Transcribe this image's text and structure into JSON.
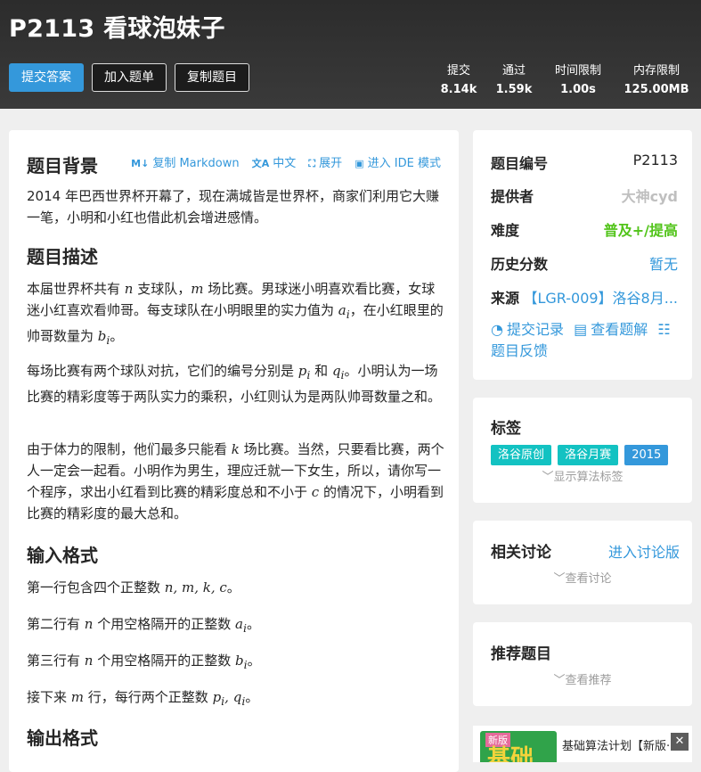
{
  "header": {
    "title": "P2113 看球泡妹子",
    "buttons": {
      "submit": "提交答案",
      "add_list": "加入题单",
      "copy": "复制题目"
    },
    "stats": [
      {
        "label": "提交",
        "value": "8.14k"
      },
      {
        "label": "通过",
        "value": "1.59k"
      },
      {
        "label": "时间限制",
        "value": "1.00s"
      },
      {
        "label": "内存限制",
        "value": "125.00MB"
      }
    ]
  },
  "main": {
    "toolbar": {
      "copy_md": "复制 Markdown",
      "lang": "中文",
      "expand": "展开",
      "ide": "进入 IDE 模式"
    },
    "background_title": "题目背景",
    "background_text": "2014 年巴西世界杯开幕了，现在满城皆是世界杯，商家们利用它大赚一笔，小明和小红也借此机会增进感情。",
    "desc_title": "题目描述",
    "desc_p1a": "本届世界杯共有 ",
    "desc_p1b": " 支球队，",
    "desc_p1c": " 场比赛。男球迷小明喜欢看比赛，女球迷小红喜欢看帅哥。每支球队在小明眼里的实力值为 ",
    "desc_p1d": "，在小红眼里的帅哥数量为 ",
    "desc_p1e": "。",
    "desc_p2a": "每场比赛有两个球队对抗，它们的编号分别是 ",
    "desc_p2b": " 和 ",
    "desc_p2c": "。小明认为一场比赛的精彩度等于两队实力的乘积，小红则认为是两队帅哥数量之和。",
    "desc_p3a": "由于体力的限制，他们最多只能看 ",
    "desc_p3b": " 场比赛。当然，只要看比赛，两个人一定会一起看。小明作为男生，理应迁就一下女生，所以，请你写一个程序，求出小红看到比赛的精彩度总和不小于 ",
    "desc_p3c": " 的情况下，小明看到比赛的精彩度的最大总和。",
    "input_title": "输入格式",
    "in1a": "第一行包含四个正整数 ",
    "in1m": "n, m, k, c",
    "in1b": "。",
    "in2a": "第二行有 ",
    "in2b": " 个用空格隔开的正整数 ",
    "in2c": "。",
    "in3a": "第三行有 ",
    "in3b": " 个用空格隔开的正整数 ",
    "in3c": "。",
    "in4a": "接下来 ",
    "in4b": " 行，每行两个正整数 ",
    "in4m": "p",
    "in4c": "。",
    "output_title": "输出格式",
    "math": {
      "n": "n",
      "m": "m",
      "k": "k",
      "c": "c",
      "a": "a",
      "b": "b",
      "p": "p",
      "q": "q",
      "i": "i",
      "comma": ", "
    }
  },
  "info": {
    "id_label": "题目编号",
    "id_value": "P2113",
    "provider_label": "提供者",
    "provider_value": "大神cyd",
    "difficulty_label": "难度",
    "difficulty_value": "普及+/提高",
    "score_label": "历史分数",
    "score_value": "暂无",
    "source_label": "来源",
    "source_value": "【LGR-009】洛谷8月...",
    "links": {
      "records": "提交记录",
      "solutions": "查看题解",
      "feedback": "题目反馈"
    }
  },
  "tags": {
    "title": "标签",
    "items": [
      "洛谷原创",
      "洛谷月赛",
      "2015"
    ],
    "show_algo": "显示算法标签"
  },
  "discuss": {
    "title": "相关讨论",
    "link": "进入讨论版",
    "more": "查看讨论"
  },
  "recommend": {
    "title": "推荐题目",
    "more": "查看推荐"
  },
  "ad": {
    "badge": "新版",
    "big": "基础",
    "text": "基础算法计划【新版·已",
    "close": "✕"
  },
  "colors": {
    "accent": "#3498db",
    "difficulty": "#52c41a",
    "tag_cyan": "#13c2c2",
    "tag_blue": "#3498db",
    "provider": "#bfbfbf"
  }
}
